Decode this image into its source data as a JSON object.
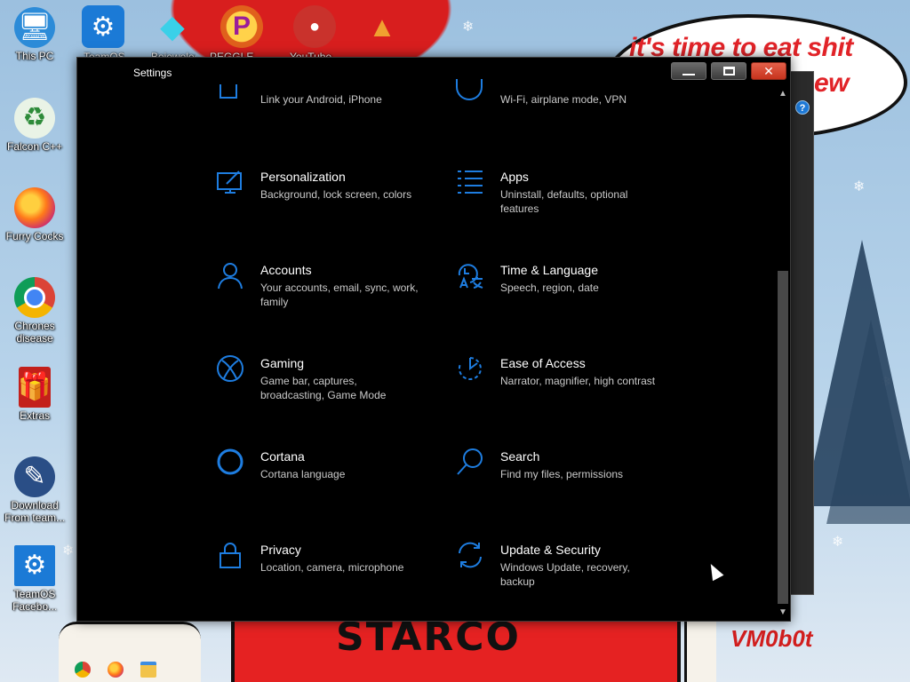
{
  "wallpaper": {
    "speech_text": "it's time to eat shit",
    "speech_text_cont": "ew",
    "bottom_text": "STARCO",
    "signature": "VM0b0t"
  },
  "desktop_icons": [
    {
      "label": "This PC",
      "icon": "computer-icon"
    },
    {
      "label": "Falcon C++",
      "icon": "recycle-icon"
    },
    {
      "label": "Furry Cocks",
      "icon": "firefox-icon"
    },
    {
      "label": "Chrones disease",
      "icon": "chrome-icon"
    },
    {
      "label": "Extras",
      "icon": "gift-icon"
    },
    {
      "label": "Download From team...",
      "icon": "download-icon"
    },
    {
      "label": "TeamOS Facebo...",
      "icon": "gear-icon"
    }
  ],
  "top_icons": [
    {
      "label": "TeamOS",
      "icon": "gear-icon"
    },
    {
      "label": "Bejeweled",
      "icon": "diamond-icon"
    },
    {
      "label": "PEGGLE",
      "icon": "peggle-icon"
    },
    {
      "label": "YouTube",
      "icon": "angry-birds-icon"
    },
    {
      "label": "",
      "icon": "candy-icon"
    }
  ],
  "settings": {
    "title": "Settings",
    "close_glyph": "✕",
    "partial_top": {
      "left_desc": "Link your Android, iPhone",
      "right_desc": "Wi-Fi, airplane mode, VPN"
    },
    "tiles": [
      {
        "title": "Personalization",
        "desc": "Background, lock screen, colors",
        "icon": "personalization-icon"
      },
      {
        "title": "Apps",
        "desc": "Uninstall, defaults, optional features",
        "icon": "apps-icon"
      },
      {
        "title": "Accounts",
        "desc": "Your accounts, email, sync, work, family",
        "icon": "accounts-icon"
      },
      {
        "title": "Time & Language",
        "desc": "Speech, region, date",
        "icon": "time-language-icon"
      },
      {
        "title": "Gaming",
        "desc": "Game bar, captures, broadcasting, Game Mode",
        "icon": "xbox-icon"
      },
      {
        "title": "Ease of Access",
        "desc": "Narrator, magnifier, high contrast",
        "icon": "ease-of-access-icon"
      },
      {
        "title": "Cortana",
        "desc": "Cortana language",
        "icon": "cortana-icon"
      },
      {
        "title": "Search",
        "desc": "Find my files, permissions",
        "icon": "search-icon"
      },
      {
        "title": "Privacy",
        "desc": "Location, camera, microphone",
        "icon": "lock-icon"
      },
      {
        "title": "Update & Security",
        "desc": "Windows Update, recovery, backup",
        "icon": "update-icon"
      }
    ]
  },
  "colors": {
    "accent": "#1e7de0",
    "window_bg": "#000000",
    "close_red": "#d9452e"
  }
}
